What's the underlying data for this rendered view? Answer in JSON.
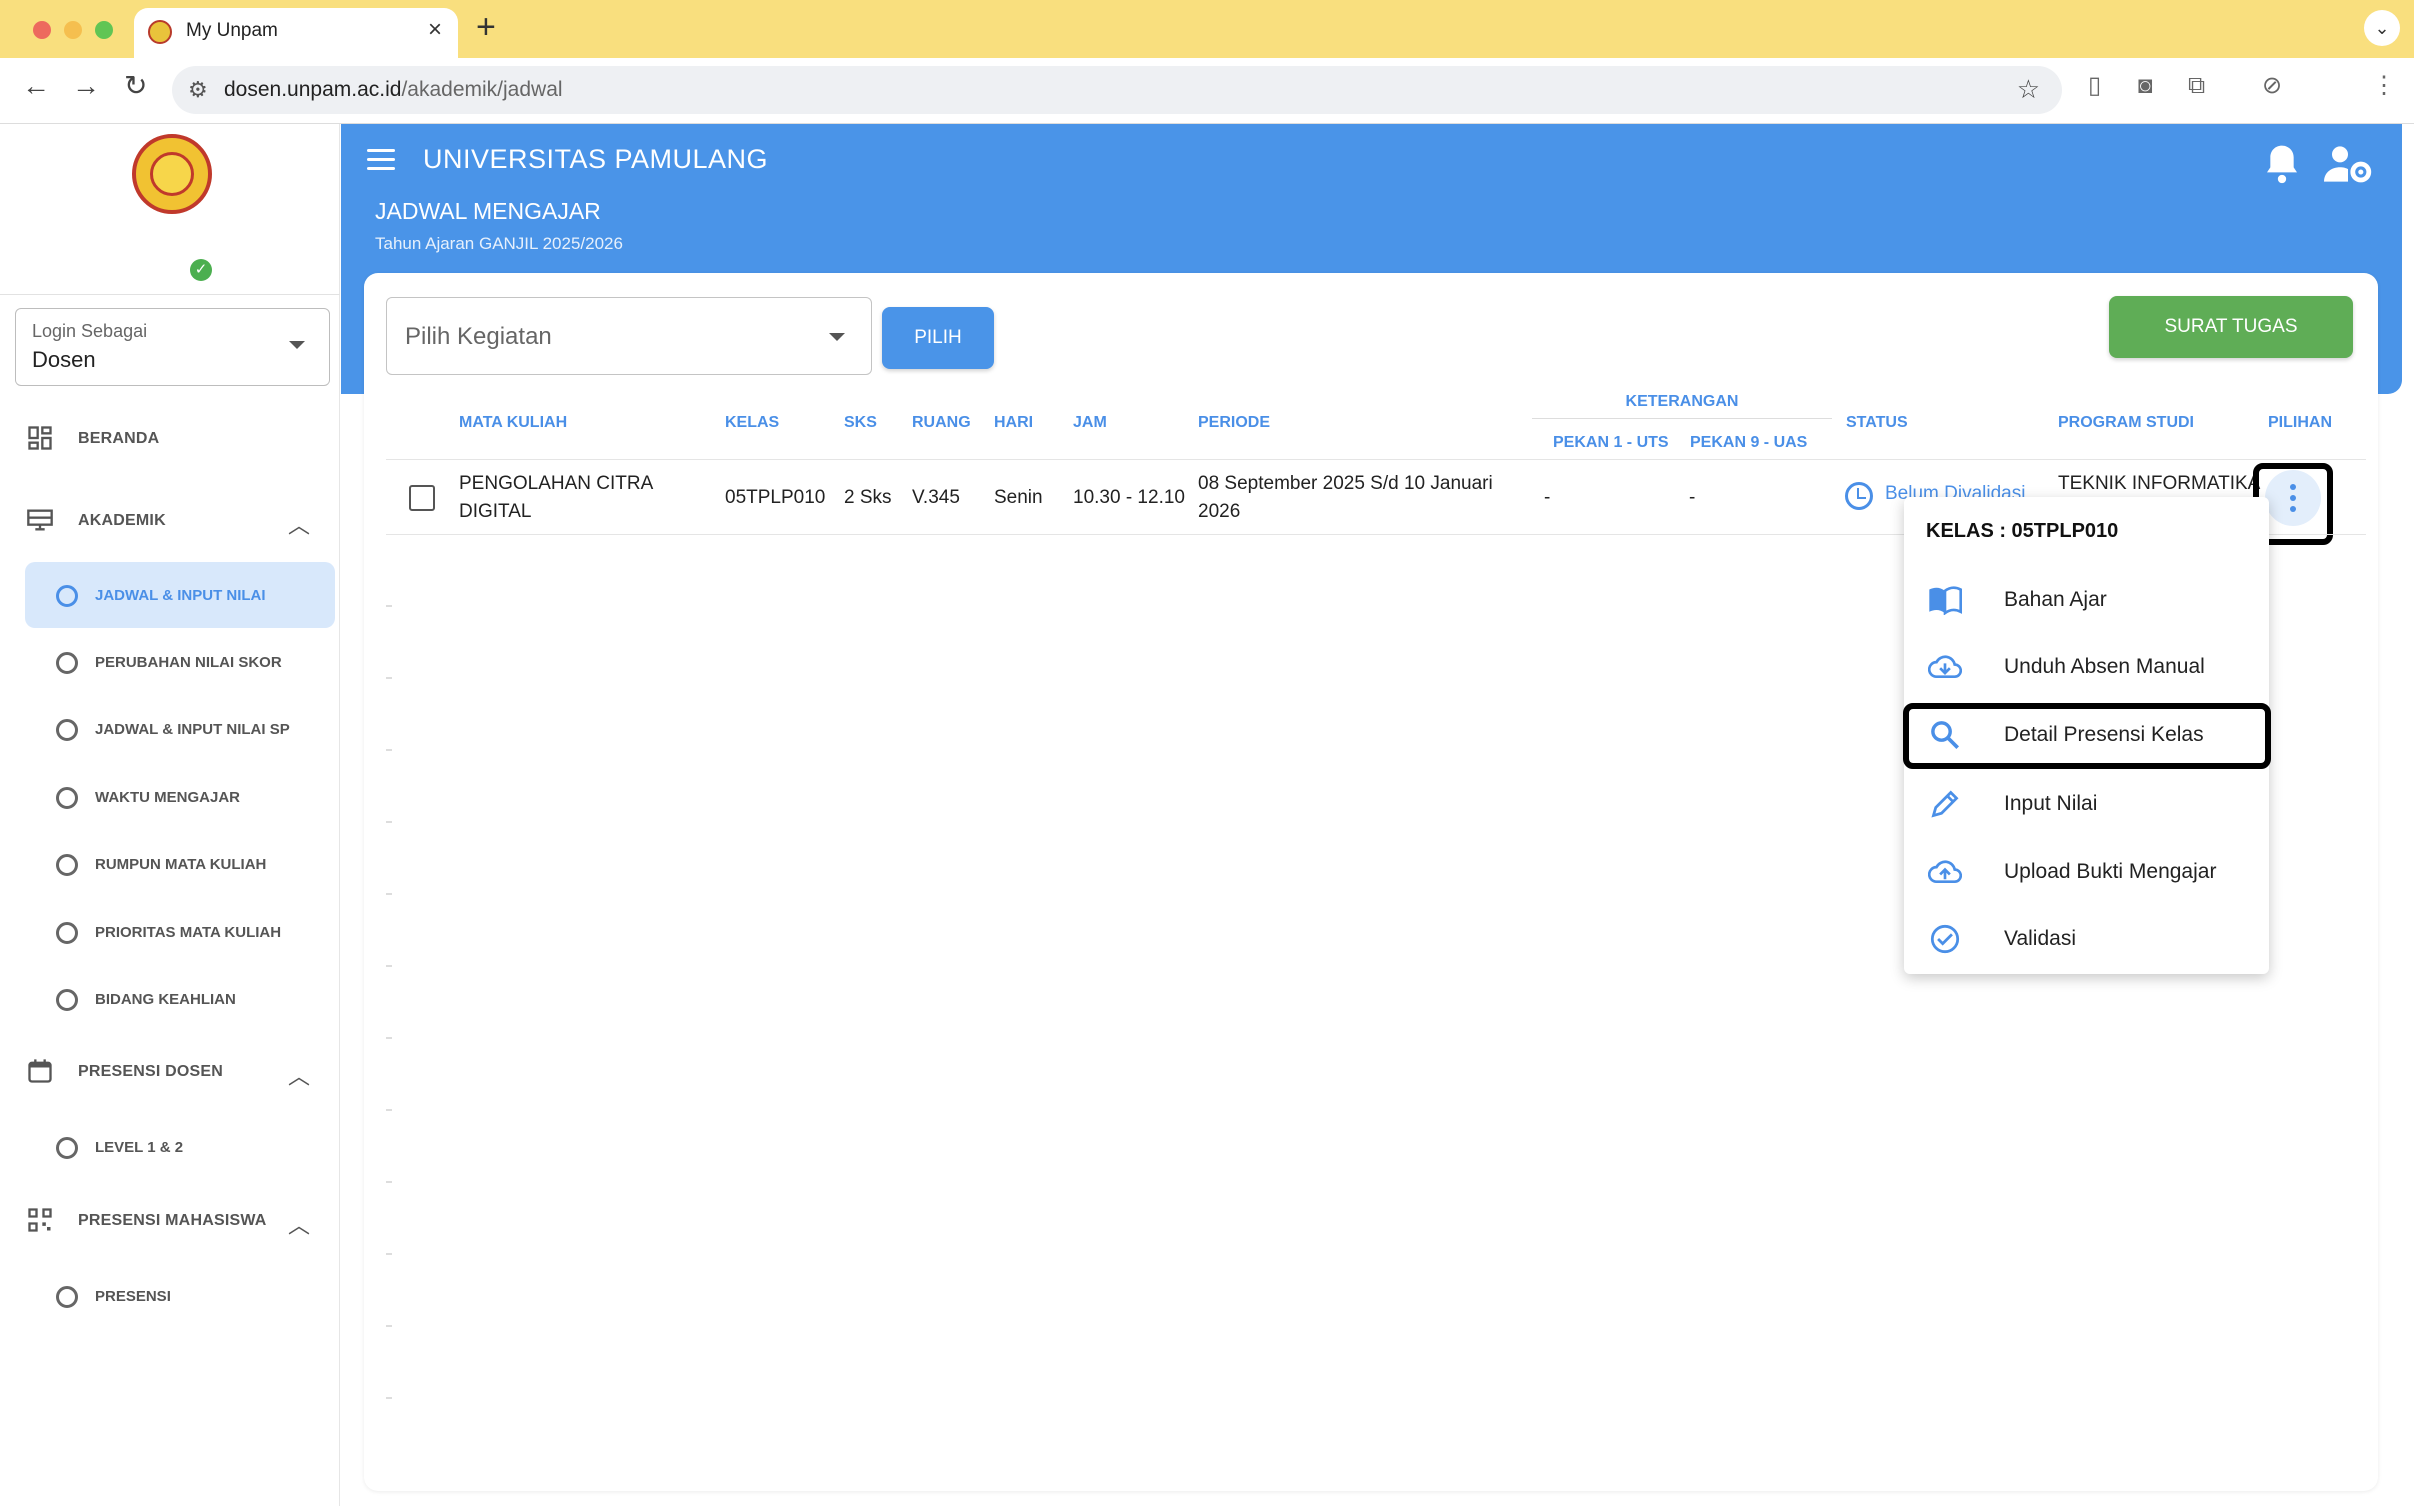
{
  "browser": {
    "tab_title": "My Unpam",
    "url_host": "dosen.unpam.ac.id",
    "url_path": "/akademik/jadwal"
  },
  "sidebar": {
    "login_label": "Login Sebagai",
    "login_value": "Dosen",
    "menu": {
      "beranda": "BERANDA",
      "akademik": "AKADEMIK",
      "akademik_items": [
        "JADWAL & INPUT NILAI",
        "PERUBAHAN NILAI SKOR",
        "JADWAL & INPUT NILAI SP",
        "WAKTU MENGAJAR",
        "RUMPUN MATA KULIAH",
        "PRIORITAS MATA KULIAH",
        "BIDANG KEAHLIAN"
      ],
      "presensi_dosen": "PRESENSI DOSEN",
      "presensi_dosen_items": [
        "LEVEL 1 & 2"
      ],
      "presensi_mahasiswa": "PRESENSI MAHASISWA",
      "presensi_mahasiswa_items": [
        "PRESENSI"
      ]
    }
  },
  "header": {
    "app_title": "UNIVERSITAS PAMULANG",
    "page_title": "JADWAL MENGAJAR",
    "page_subtitle": "Tahun Ajaran GANJIL 2025/2026"
  },
  "toolbar": {
    "select_placeholder": "Pilih Kegiatan",
    "pilih_label": "PILIH",
    "surat_tugas_label": "SURAT TUGAS"
  },
  "table": {
    "headers": {
      "mata_kuliah": "MATA KULIAH",
      "kelas": "KELAS",
      "sks": "SKS",
      "ruang": "RUANG",
      "hari": "HARI",
      "jam": "JAM",
      "periode": "PERIODE",
      "keterangan": "KETERANGAN",
      "pekan_uts": "PEKAN 1 - UTS",
      "pekan_uas": "PEKAN 9 - UAS",
      "status": "STATUS",
      "program_studi": "PROGRAM STUDI",
      "pilihan": "PILIHAN"
    },
    "row": {
      "mata_kuliah_line1": "PENGOLAHAN CITRA",
      "mata_kuliah_line2": "DIGITAL",
      "kelas": "05TPLP010",
      "sks": "2 Sks",
      "ruang": "V.345",
      "hari": "Senin",
      "jam": "10.30 - 12.10",
      "periode_line1": "08 September 2025 S/d 10 Januari",
      "periode_line2": "2026",
      "pekan_uts": "-",
      "pekan_uas": "-",
      "status": "Belum Divalidasi",
      "program_studi": "TEKNIK INFORMATIKA"
    }
  },
  "popup": {
    "title": "KELAS : 05TPLP010",
    "items": [
      {
        "label": "Bahan Ajar",
        "icon": "book-open-icon"
      },
      {
        "label": "Unduh Absen Manual",
        "icon": "cloud-download-icon"
      },
      {
        "label": "Detail Presensi Kelas",
        "icon": "search-icon"
      },
      {
        "label": "Input Nilai",
        "icon": "pencil-icon"
      },
      {
        "label": "Upload Bukti Mengajar",
        "icon": "cloud-upload-icon"
      },
      {
        "label": "Validasi",
        "icon": "check-circle-icon"
      }
    ]
  },
  "colors": {
    "primary": "#4a94e8",
    "success": "#5fad56",
    "active_bg": "#d8e8fb",
    "tabbar": "#f9df7e"
  }
}
